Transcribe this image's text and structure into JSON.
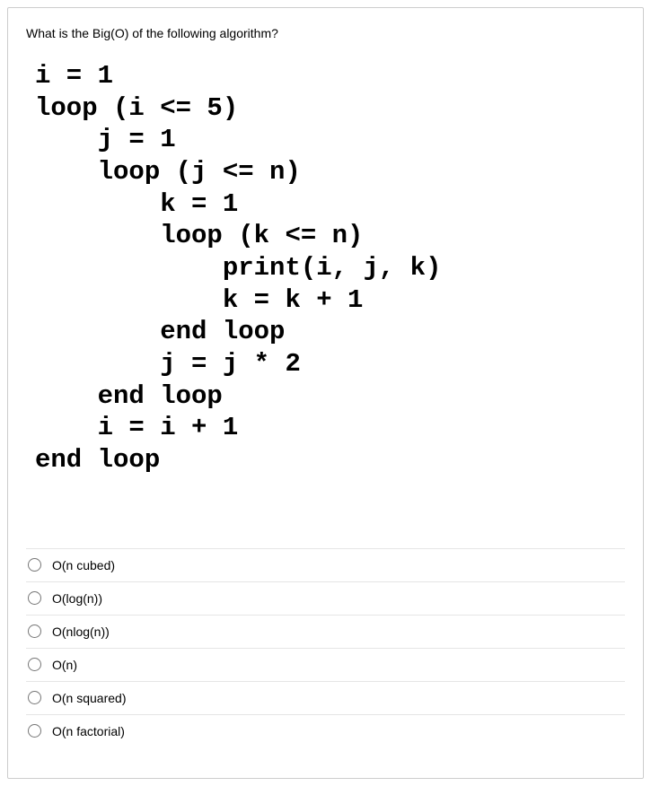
{
  "question": "What is the Big(O) of the following algorithm?",
  "code": "i = 1\nloop (i <= 5)\n    j = 1\n    loop (j <= n)\n        k = 1\n        loop (k <= n)\n            print(i, j, k)\n            k = k + 1\n        end loop\n        j = j * 2\n    end loop\n    i = i + 1\nend loop",
  "options": [
    "O(n cubed)",
    "O(log(n))",
    "O(nlog(n))",
    "O(n)",
    "O(n squared)",
    "O(n factorial)"
  ]
}
